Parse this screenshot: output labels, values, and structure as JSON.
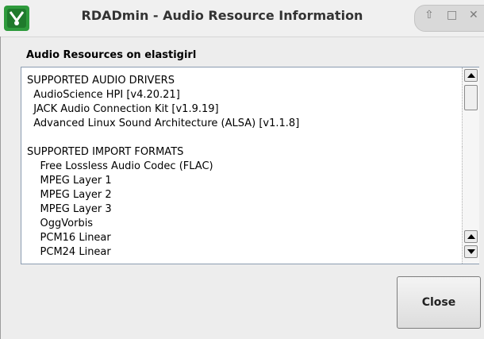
{
  "window": {
    "title": "RDADmin - Audio Resource Information",
    "icon": "rdadmin-app-icon",
    "controls": [
      "restore-icon",
      "maximize-icon",
      "close-icon"
    ]
  },
  "section_label": "Audio Resources on elastigirl",
  "list": {
    "lines": [
      "SUPPORTED AUDIO DRIVERS",
      "  AudioScience HPI [v4.20.21]",
      "  JACK Audio Connection Kit [v1.9.19]",
      "  Advanced Linux Sound Architecture (ALSA) [v1.1.8]",
      "",
      "SUPPORTED IMPORT FORMATS",
      "    Free Lossless Audio Codec (FLAC)",
      "    MPEG Layer 1",
      "    MPEG Layer 2",
      "    MPEG Layer 3",
      "    OggVorbis",
      "    PCM16 Linear",
      "    PCM24 Linear"
    ]
  },
  "buttons": {
    "close": "Close"
  },
  "colors": {
    "list_border": "#8b9cb1",
    "icon_green": "#2e9a3c"
  }
}
